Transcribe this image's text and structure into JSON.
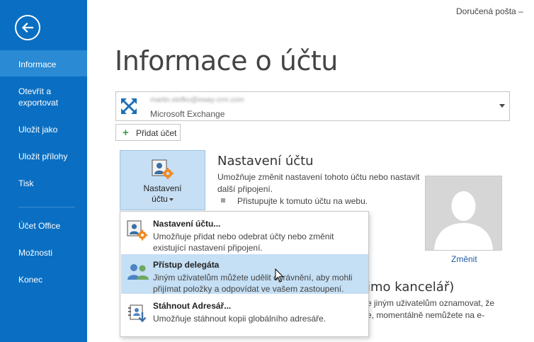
{
  "window_title": "Doručená pošta – ",
  "page_title": "Informace o účtu",
  "sidebar": {
    "items": [
      {
        "label": "Informace"
      },
      {
        "label": "Otevřít a exportovat"
      },
      {
        "label": "Uložit jako"
      },
      {
        "label": "Uložit přílohy"
      },
      {
        "label": "Tisk"
      },
      {
        "label": "Účet Office"
      },
      {
        "label": "Možnosti"
      },
      {
        "label": "Konec"
      }
    ]
  },
  "account": {
    "email": "martin.stefko@eway-crm.com",
    "type": "Microsoft Exchange"
  },
  "add_account_label": "Přidat účet",
  "settings_tile": {
    "label_line1": "Nastavení",
    "label_line2": "účtu"
  },
  "section": {
    "heading": "Nastavení účtu",
    "description": "Umožňuje změnit nastavení tohoto účtu nebo nastavit další připojení.",
    "bullet_link": "Přistupujte k tomuto účtu na webu."
  },
  "profile": {
    "change_label": "Změnit"
  },
  "background_section": {
    "heading": "imo kancelář)",
    "line1": "e jiným uživatelům oznamovat, že",
    "line2": "e, momentálně nemůžete na e-"
  },
  "dropdown": {
    "items": [
      {
        "title": "Nastavení účtu...",
        "description": "Umožňuje přidat nebo odebrat účty nebo změnit existující nastavení připojení."
      },
      {
        "title": "Přístup delegáta",
        "description": "Jiným uživatelům můžete udělit oprávnění, aby mohli přijímat položky a odpovídat ve vašem zastoupení."
      },
      {
        "title": "Stáhnout Adresář...",
        "description": "Umožňuje stáhnout kopii globálního adresáře."
      }
    ]
  },
  "colors": {
    "sidebar_bg": "#0a6fc2",
    "sidebar_selected": "#2a8ad4",
    "tile_bg": "#c7dff4",
    "menu_hover": "#c5dff4",
    "link": "#1e5fa8"
  },
  "icons": {
    "back": "back-arrow-icon",
    "exchange": "exchange-icon",
    "add": "plus-icon",
    "settings": "account-settings-icon",
    "delegate": "delegate-access-icon",
    "address_book": "address-book-download-icon",
    "avatar": "avatar-placeholder-icon"
  }
}
